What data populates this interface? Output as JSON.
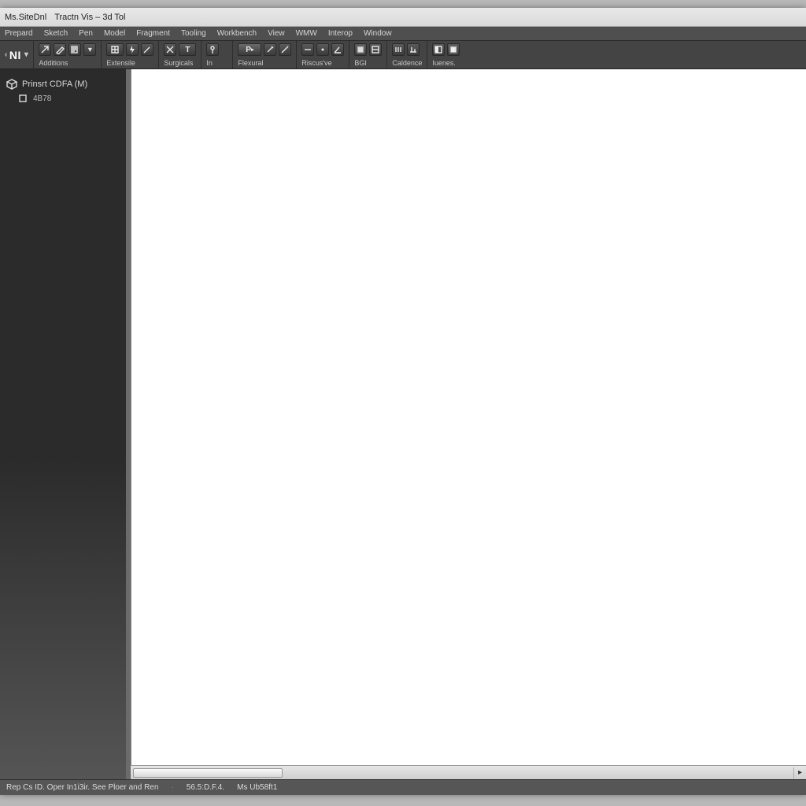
{
  "title": {
    "left": "Ms.SiteDnl",
    "right": "Tractn Vis – 3d Tol"
  },
  "menu": [
    "Prepard",
    "Sketch",
    "Pen",
    "Model",
    "Fragment",
    "Tooling",
    "Workbench",
    "View",
    "WMW",
    "Interop",
    "Window"
  ],
  "ribbon": {
    "brand": "NI",
    "groups": [
      {
        "label": "Additions",
        "icons": [
          "arrow-ne",
          "pen",
          "sheet",
          "chev"
        ]
      },
      {
        "label": "Extensile",
        "icons": [
          "grid",
          "bolt",
          "pen"
        ]
      },
      {
        "label": "Surgicals",
        "icons": [
          "cut",
          "text"
        ]
      },
      {
        "label": "In",
        "icons": [
          "pin"
        ]
      },
      {
        "label": "Flexural",
        "icons": [
          "flag-p",
          "tool",
          "pen"
        ]
      },
      {
        "label": "Riscus've",
        "icons": [
          "dash",
          "dot",
          "angle"
        ]
      },
      {
        "label": "BGI",
        "icons": [
          "sq-a",
          "sq-b"
        ]
      },
      {
        "label": "Caldence",
        "icons": [
          "bars-a",
          "bars-b"
        ]
      },
      {
        "label": "Iuenes.",
        "icons": [
          "half",
          "square"
        ]
      }
    ]
  },
  "sidebar": {
    "root": "Prinsrt CDFA (M)",
    "child": "4B78"
  },
  "status": {
    "left": "Rep Cs ID. Oper In1i3ir. See Ploer and Ren",
    "mid1": "56.5:D.F.4.",
    "mid2": "Ms  Ub58ft1"
  }
}
